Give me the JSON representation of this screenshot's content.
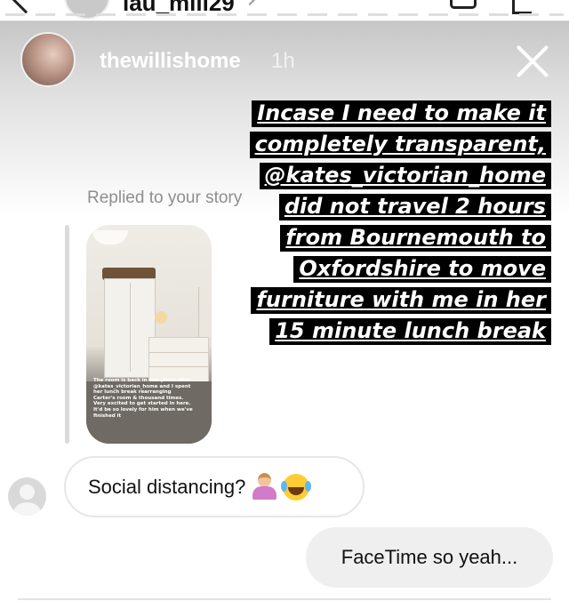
{
  "header": {
    "username": "lau_mili29"
  },
  "story": {
    "username": "thewillishome",
    "time": "1h",
    "caption_lines": [
      "Incase I need to make it",
      "completely transparent,",
      "@kates_victorian_home",
      "did not travel 2 hours",
      "from Bournemouth to",
      "Oxfordshire to move",
      "furniture with me in her",
      "15 minute lunch break"
    ],
    "thumbnail_caption": "The room is back in one piece after @kates_victorian_home and I spent her lunch break rearranging Carter's room & thousand times. Very excited to get started in here. It'd be so lovely for him when we've finished it"
  },
  "reply_label": "Replied to your story",
  "messages": {
    "received": {
      "text": "Social distancing?"
    },
    "sent": {
      "text": "FaceTime so yeah..."
    }
  },
  "icons": {
    "close": "close-icon",
    "back": "back-arrow-icon",
    "video": "video-call-icon",
    "info": "info-icon"
  },
  "colors": {
    "caption_bg": "#000000",
    "caption_text": "#ffffff",
    "sent_bubble": "#efefef",
    "received_border": "#e6e6e6",
    "muted_text": "#8e8e8e"
  }
}
